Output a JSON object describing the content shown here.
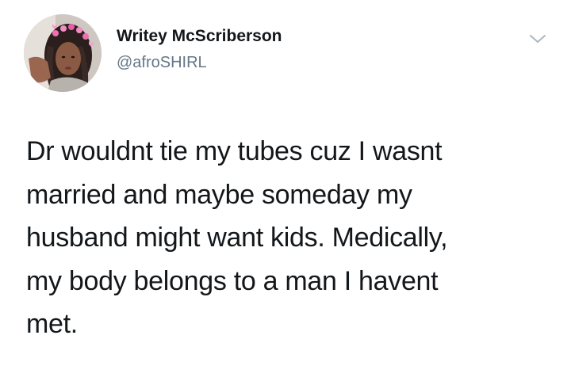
{
  "tweet": {
    "author": {
      "display_name": "Writey McScriberson",
      "handle": "@afroSHIRL",
      "avatar_icon": "profile-photo"
    },
    "menu_icon": "chevron-down-icon",
    "text_lines": [
      "Dr wouldnt tie my tubes cuz I wasnt",
      "married and maybe someday my",
      "husband might want kids. Medically,",
      "my body belongs to a man I havent",
      "met."
    ]
  },
  "colors": {
    "text_primary": "#14171a",
    "text_secondary": "#657786",
    "chevron": "#aab8c2",
    "background": "#ffffff"
  }
}
